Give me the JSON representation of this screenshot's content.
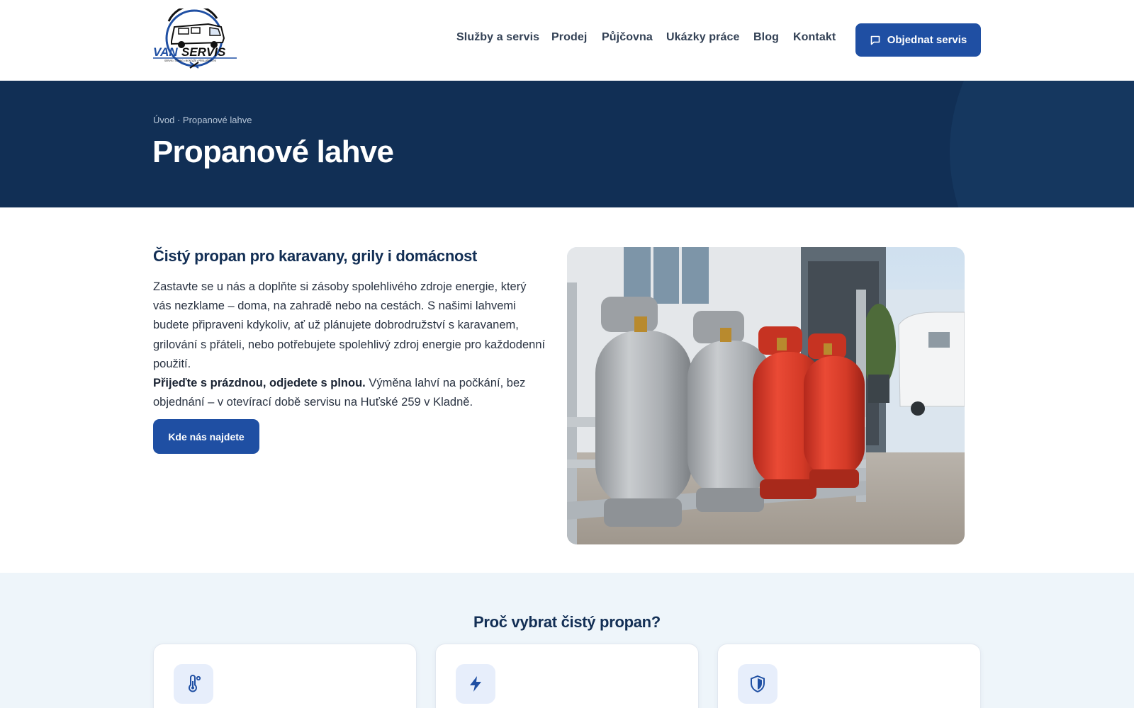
{
  "brand": {
    "logo_text_van": "VAN",
    "logo_text_servis": "SERVIS",
    "logo_tagline": "SERVIS • TUNING • MONTÁŽE • PŘÍSLUŠENSTVÍ",
    "accent": "#1f4fa3",
    "navy": "#112f55"
  },
  "nav": {
    "items": [
      {
        "label": "Služby a servis"
      },
      {
        "label": "Prodej"
      },
      {
        "label": "Půjčovna"
      },
      {
        "label": "Ukázky práce"
      },
      {
        "label": "Blog"
      },
      {
        "label": "Kontakt"
      }
    ],
    "cta_label": "Objednat servis",
    "cta_icon": "chat-bubble-icon"
  },
  "hero": {
    "breadcrumb": "Úvod · Propanové lahve",
    "title": "Propanové lahve"
  },
  "intro": {
    "heading": "Čistý propan pro karavany, grily i domácnost",
    "paragraph": "Zastavte se u nás a doplňte si zásoby spolehlivého zdroje energie, který vás nezklame – doma, na zahradě nebo na cestách. S našimi lahvemi budete připraveni kdykoliv, ať už plánujete dobrodružství s karavanem, grilování s přáteli, nebo potřebujete spolehlivý zdroj energie pro každodenní použití.",
    "highlight_bold": "Přijeďte s prázdnou, odjedete s plnou.",
    "highlight_rest": " Výměna lahví na počkání, bez objednání – v otevírací době servisu na Huťské 259 v Kladně.",
    "button_label": "Kde nás najdete"
  },
  "features": {
    "heading": "Proč vybrat čistý propan?",
    "cards": [
      {
        "icon": "thermometer-icon"
      },
      {
        "icon": "lightning-icon"
      },
      {
        "icon": "shield-icon"
      }
    ]
  }
}
